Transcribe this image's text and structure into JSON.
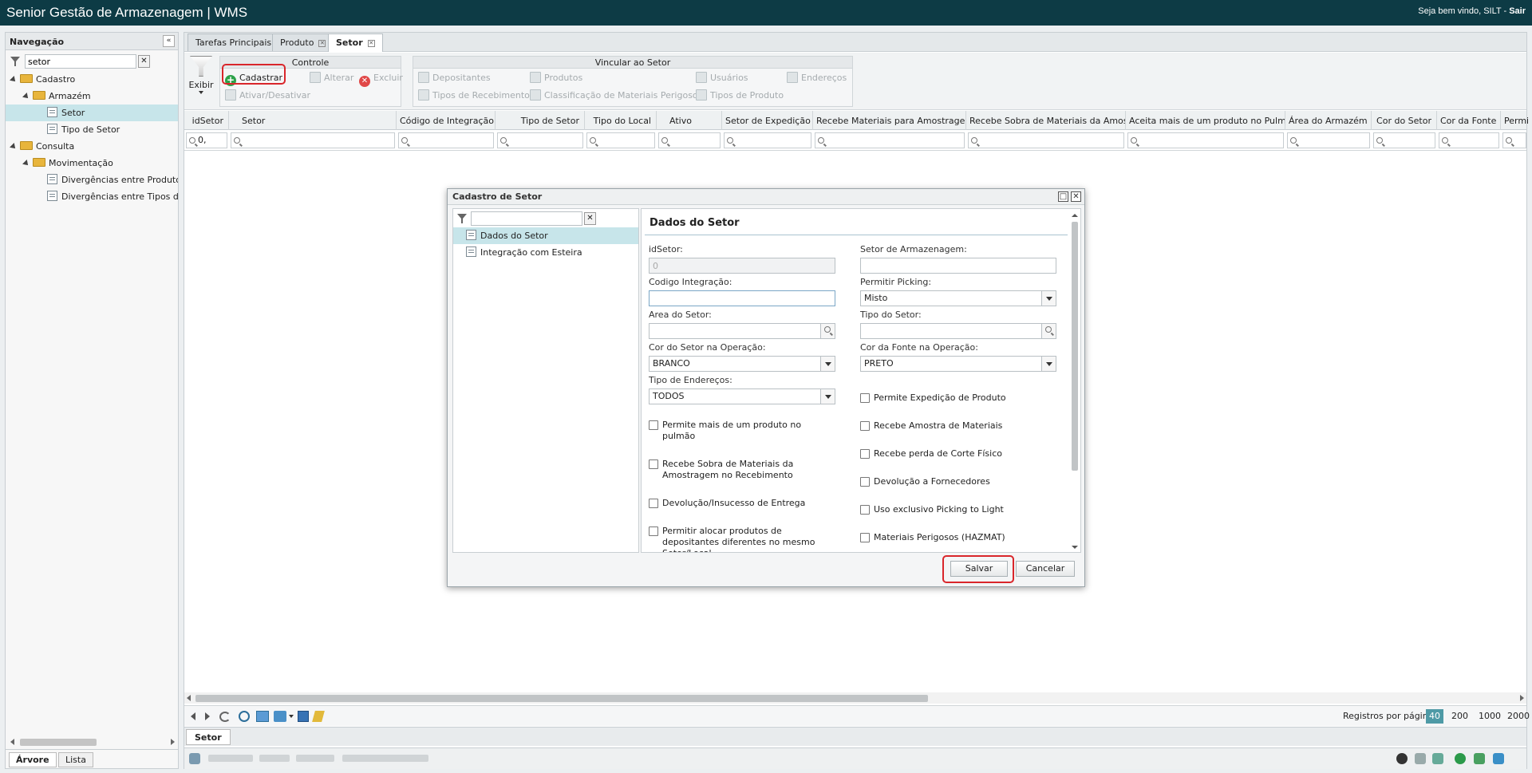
{
  "app": {
    "title": "Senior Gestão de Armazenagem | WMS",
    "welcome_prefix": "Seja bem vindo, SILT - ",
    "logout": "Sair"
  },
  "nav": {
    "title": "Navegação",
    "filter_value": "setor",
    "tree": [
      {
        "label": "Cadastro",
        "type": "folder",
        "level": 0
      },
      {
        "label": "Armazém",
        "type": "folder",
        "level": 1
      },
      {
        "label": "Setor",
        "type": "page",
        "level": 2,
        "selected": true
      },
      {
        "label": "Tipo de Setor",
        "type": "page",
        "level": 2
      },
      {
        "label": "Consulta",
        "type": "folder",
        "level": 0
      },
      {
        "label": "Movimentação",
        "type": "folder",
        "level": 1
      },
      {
        "label": "Divergências entre Produtos e",
        "type": "page",
        "level": 2
      },
      {
        "label": "Divergências entre Tipos de P",
        "type": "page",
        "level": 2
      }
    ],
    "tabs": [
      "Árvore",
      "Lista"
    ]
  },
  "tabs": [
    "Tarefas Principais",
    "Produto",
    "Setor"
  ],
  "toolbar": {
    "exibir": "Exibir",
    "controle": {
      "title": "Controle",
      "cadastrar": "Cadastrar",
      "alterar": "Alterar",
      "excluir": "Excluir",
      "ativar": "Ativar/Desativar"
    },
    "vincular": {
      "title": "Vincular ao Setor",
      "items": [
        "Depositantes",
        "Produtos",
        "Usuários",
        "Endereços",
        "Tipos de Recebimento",
        "Classificação de Materiais Perigosos",
        "Tipos de Produto"
      ]
    }
  },
  "grid": {
    "columns": [
      "idSetor",
      "Setor",
      "Código de Integração",
      "Tipo de Setor",
      "Tipo do Local",
      "Ativo",
      "Setor de Expedição",
      "Recebe Materiais para Amostragem",
      "Recebe Sobra de Materiais da Amostr...",
      "Aceita mais de um produto no Pulmão",
      "Área do Armazém",
      "Cor do Setor",
      "Cor da Fonte",
      "Permit"
    ],
    "filter_first": "0,"
  },
  "pager": {
    "label": "Registros por página:",
    "options": [
      "40",
      "200",
      "1000",
      "2000"
    ],
    "selected": "40"
  },
  "bottom_tab": "Setor",
  "dialog": {
    "title": "Cadastro de Setor",
    "menu": [
      "Dados do Setor",
      "Integração com Esteira"
    ],
    "section": "Dados do Setor",
    "fields": {
      "idsetor_label": "idSetor:",
      "idsetor_value": "0",
      "setor_arm_label": "Setor de Armazenagem:",
      "setor_arm_value": "",
      "codigo_label": "Codigo Integração:",
      "codigo_value": "",
      "picking_label": "Permitir Picking:",
      "picking_value": "Misto",
      "area_label": "Area do Setor:",
      "area_value": "",
      "tipo_label": "Tipo do Setor:",
      "tipo_value": "",
      "cor_label": "Cor do Setor na Operação:",
      "cor_value": "BRANCO",
      "fonte_label": "Cor da Fonte na Operação:",
      "fonte_value": "PRETO",
      "tipo_end_label": "Tipo de Endereços:",
      "tipo_end_value": "TODOS"
    },
    "checks_left": [
      "Permite mais de um produto no pulmão",
      "Recebe Sobra de Materiais da Amostragem no Recebimento",
      "Devolução/Insucesso de Entrega",
      "Permitir alocar produtos de depositantes diferentes no mesmo Setor/Local"
    ],
    "checks_right": [
      "Permite Expedição de Produto",
      "Recebe Amostra de Materiais",
      "Recebe perda de Corte Físico",
      "Devolução a Fornecedores",
      "Uso exclusivo Picking to Light",
      "Materiais Perigosos (HAZMAT)"
    ],
    "save": "Salvar",
    "cancel": "Cancelar"
  }
}
